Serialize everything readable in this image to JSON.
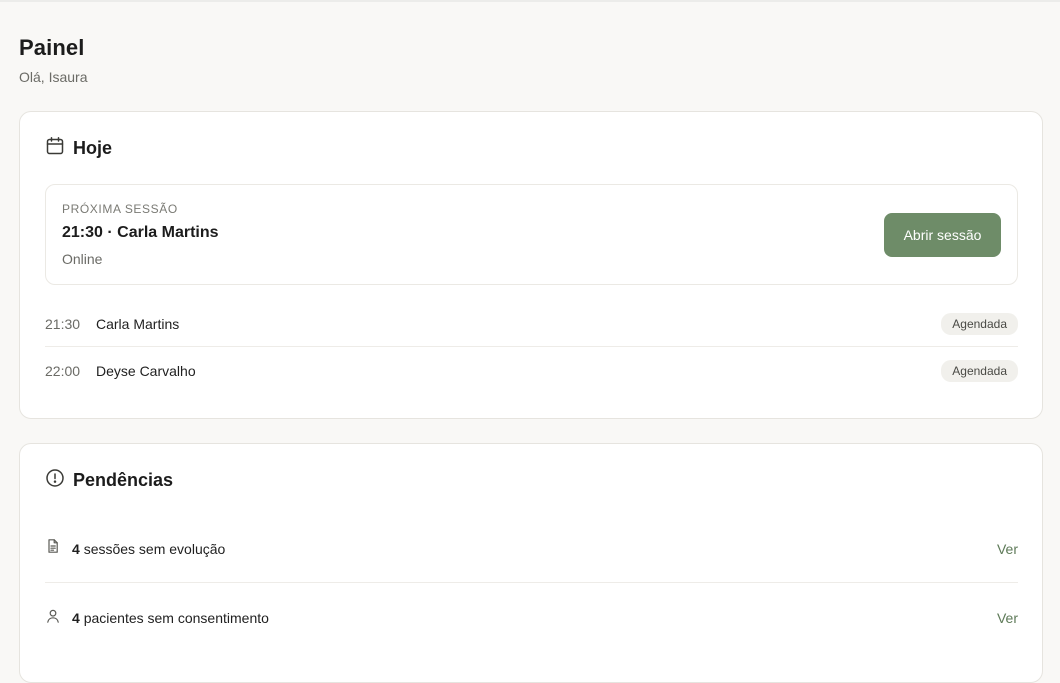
{
  "header": {
    "title": "Painel",
    "greeting": "Olá, Isaura"
  },
  "today": {
    "title": "Hoje",
    "icon": "calendar-icon",
    "next_session": {
      "kicker": "PRÓXIMA SESSÃO",
      "title": "21:30 · Carla Martins",
      "mode": "Online",
      "button_label": "Abrir sessão"
    },
    "sessions": [
      {
        "time": "21:30",
        "name": "Carla Martins",
        "status": "Agendada"
      },
      {
        "time": "22:00",
        "name": "Deyse Carvalho",
        "status": "Agendada"
      }
    ]
  },
  "pending": {
    "title": "Pendências",
    "icon": "alert-circle-icon",
    "items": [
      {
        "icon": "document-icon",
        "count": "4",
        "text": "sessões sem evolução",
        "link": "Ver"
      },
      {
        "icon": "user-icon",
        "count": "4",
        "text": "pacientes sem consentimento",
        "link": "Ver"
      }
    ]
  },
  "colors": {
    "accent": "#6e8c68",
    "link": "#5e7a58",
    "background": "#f9f8f6"
  }
}
